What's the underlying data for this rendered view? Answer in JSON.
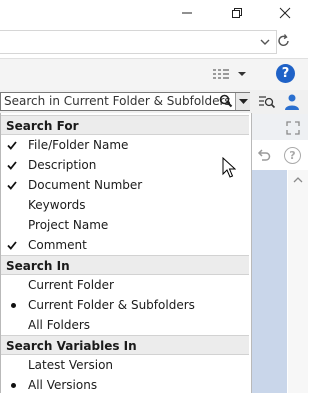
{
  "search": {
    "placeholder": "Search in Current Folder & Subfolders"
  },
  "menu": {
    "sections": [
      {
        "header": "Search For",
        "items": [
          {
            "label": "File/Folder Name",
            "mark": "check"
          },
          {
            "label": "Description",
            "mark": "check"
          },
          {
            "label": "Document Number",
            "mark": "check"
          },
          {
            "label": "Keywords",
            "mark": "none"
          },
          {
            "label": "Project Name",
            "mark": "none"
          },
          {
            "label": "Comment",
            "mark": "check"
          }
        ]
      },
      {
        "header": "Search In",
        "items": [
          {
            "label": "Current Folder",
            "mark": "none"
          },
          {
            "label": "Current Folder & Subfolders",
            "mark": "dot"
          },
          {
            "label": "All Folders",
            "mark": "none"
          }
        ]
      },
      {
        "header": "Search Variables In",
        "items": [
          {
            "label": "Latest Version",
            "mark": "none"
          },
          {
            "label": "All Versions",
            "mark": "dot"
          }
        ]
      }
    ]
  },
  "icons": {
    "window_minimize": "minimize-icon",
    "window_maximize": "restore-icon",
    "window_close": "close-icon",
    "address_dropdown": "chevron-down-icon",
    "refresh": "refresh-icon",
    "view_options": "list-view-icon",
    "help": "help-icon",
    "search": "search-icon",
    "search_dropdown": "dropdown-arrow-icon",
    "advanced_search": "advanced-search-icon",
    "user": "user-icon",
    "undo": "undo-icon",
    "expand": "expand-icon"
  },
  "colors": {
    "help_blue": "#1f62c7",
    "preview_blue": "#c9d6ea",
    "section_header_bg": "#ececec"
  },
  "help": {
    "label": "?"
  }
}
